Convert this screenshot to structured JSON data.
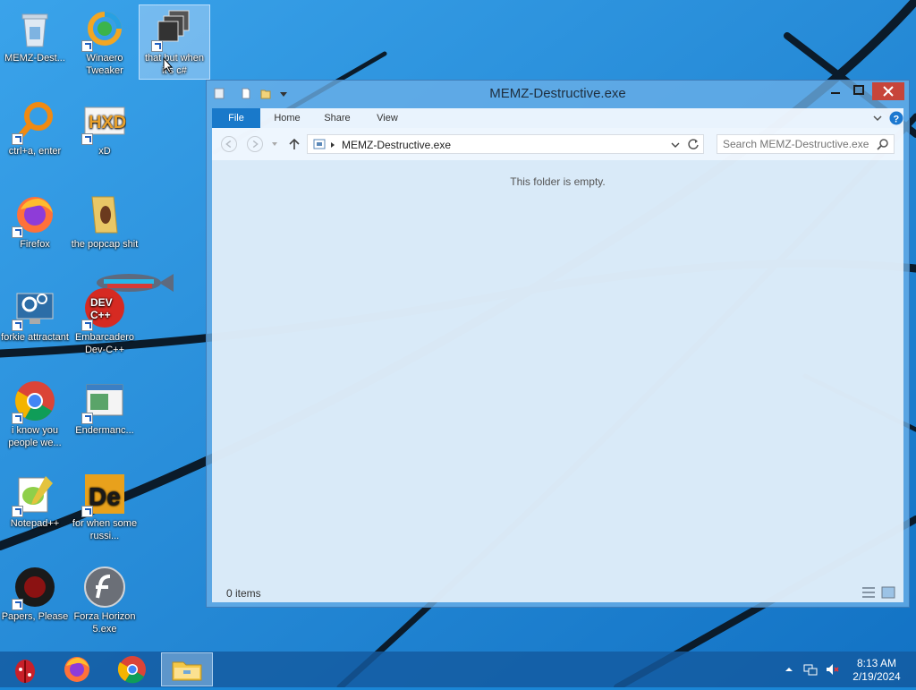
{
  "desktop": {
    "icons": [
      {
        "label": "MEMZ-Dest...",
        "icon": "recycle-bin-icon"
      },
      {
        "label": "Winaero Tweaker",
        "icon": "winaero-tweaker-icon"
      },
      {
        "label": "that but when it's c#",
        "icon": "stacked-squares-icon"
      },
      {
        "label": "ctrl+a, enter",
        "icon": "magnifier-icon"
      },
      {
        "label": "xD",
        "icon": "hxd-icon"
      },
      {
        "label": "Firefox",
        "icon": "firefox-icon"
      },
      {
        "label": "the popcap shit",
        "icon": "folder-icon"
      },
      {
        "label": "forkie attractant",
        "icon": "monitor-settings-icon"
      },
      {
        "label": "Embarcadero Dev-C++",
        "icon": "devcpp-icon"
      },
      {
        "label": "i know you people we...",
        "icon": "chrome-icon"
      },
      {
        "label": "Endermanc...",
        "icon": "app-window-icon"
      },
      {
        "label": "Notepad++",
        "icon": "notepadpp-icon"
      },
      {
        "label": "for when some russi...",
        "icon": "de-icon"
      },
      {
        "label": "Papers, Please",
        "icon": "papers-please-icon"
      },
      {
        "label": "Forza Horizon 5.exe",
        "icon": "flash-icon"
      }
    ]
  },
  "explorer": {
    "title": "MEMZ-Destructive.exe",
    "tabs": [
      "File",
      "Home",
      "Share",
      "View"
    ],
    "path": "MEMZ-Destructive.exe",
    "search_placeholder": "Search MEMZ-Destructive.exe",
    "empty_message": "This folder is empty.",
    "status": "0 items"
  },
  "taskbar": {
    "pinned": [
      "bug-icon",
      "firefox-icon",
      "chrome-icon",
      "file-explorer-icon"
    ],
    "clock": {
      "time": "8:13 AM",
      "date": "2/19/2024"
    }
  },
  "colors": {
    "desktop_bg": "#1a86d6",
    "accent_file_tab": "#1979ca",
    "close_button": "#c7453a"
  }
}
